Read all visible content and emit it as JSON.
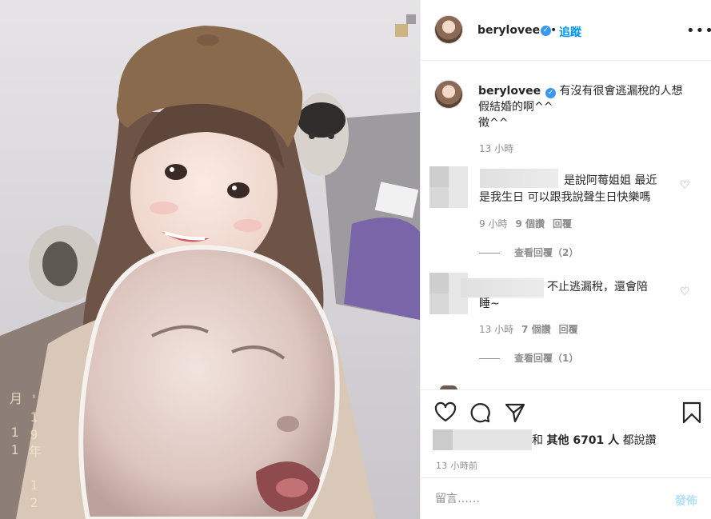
{
  "photo": {
    "date_stamp": "'19年 12月 11"
  },
  "header": {
    "username": "berylovee",
    "verified_icon": "verified-badge",
    "dot": "•",
    "follow_label": "追蹤",
    "more_icon": "•••"
  },
  "caption": {
    "username": "berylovee",
    "text_lines": [
      "有沒有很會逃漏稅的人想",
      "假結婚的啊^^",
      "徵^^"
    ],
    "time": "13 小時"
  },
  "comments": [
    {
      "text_lines": [
        "是說阿莓姐姐 最近",
        "是我生日 可以跟我說聲生日快樂嗎"
      ],
      "time": "9 小時",
      "likes": "9 個讚",
      "reply": "回覆",
      "view_replies": "查看回覆（2）"
    },
    {
      "text_lines": [
        "不止逃漏稅，還會陪",
        "睡~"
      ],
      "time": "13 小時",
      "likes": "7 個讚",
      "reply": "回覆",
      "view_replies": "查看回覆（1）"
    }
  ],
  "actions": {
    "like_icon": "heart-icon",
    "comment_icon": "comment-icon",
    "share_icon": "share-icon",
    "save_icon": "bookmark-icon"
  },
  "likes": {
    "prefix": "和",
    "others_label": "其他 6701 人",
    "suffix": "都說讚"
  },
  "post_time": "13 小時前",
  "add_comment": {
    "placeholder": "留言……",
    "post_label": "發佈"
  }
}
